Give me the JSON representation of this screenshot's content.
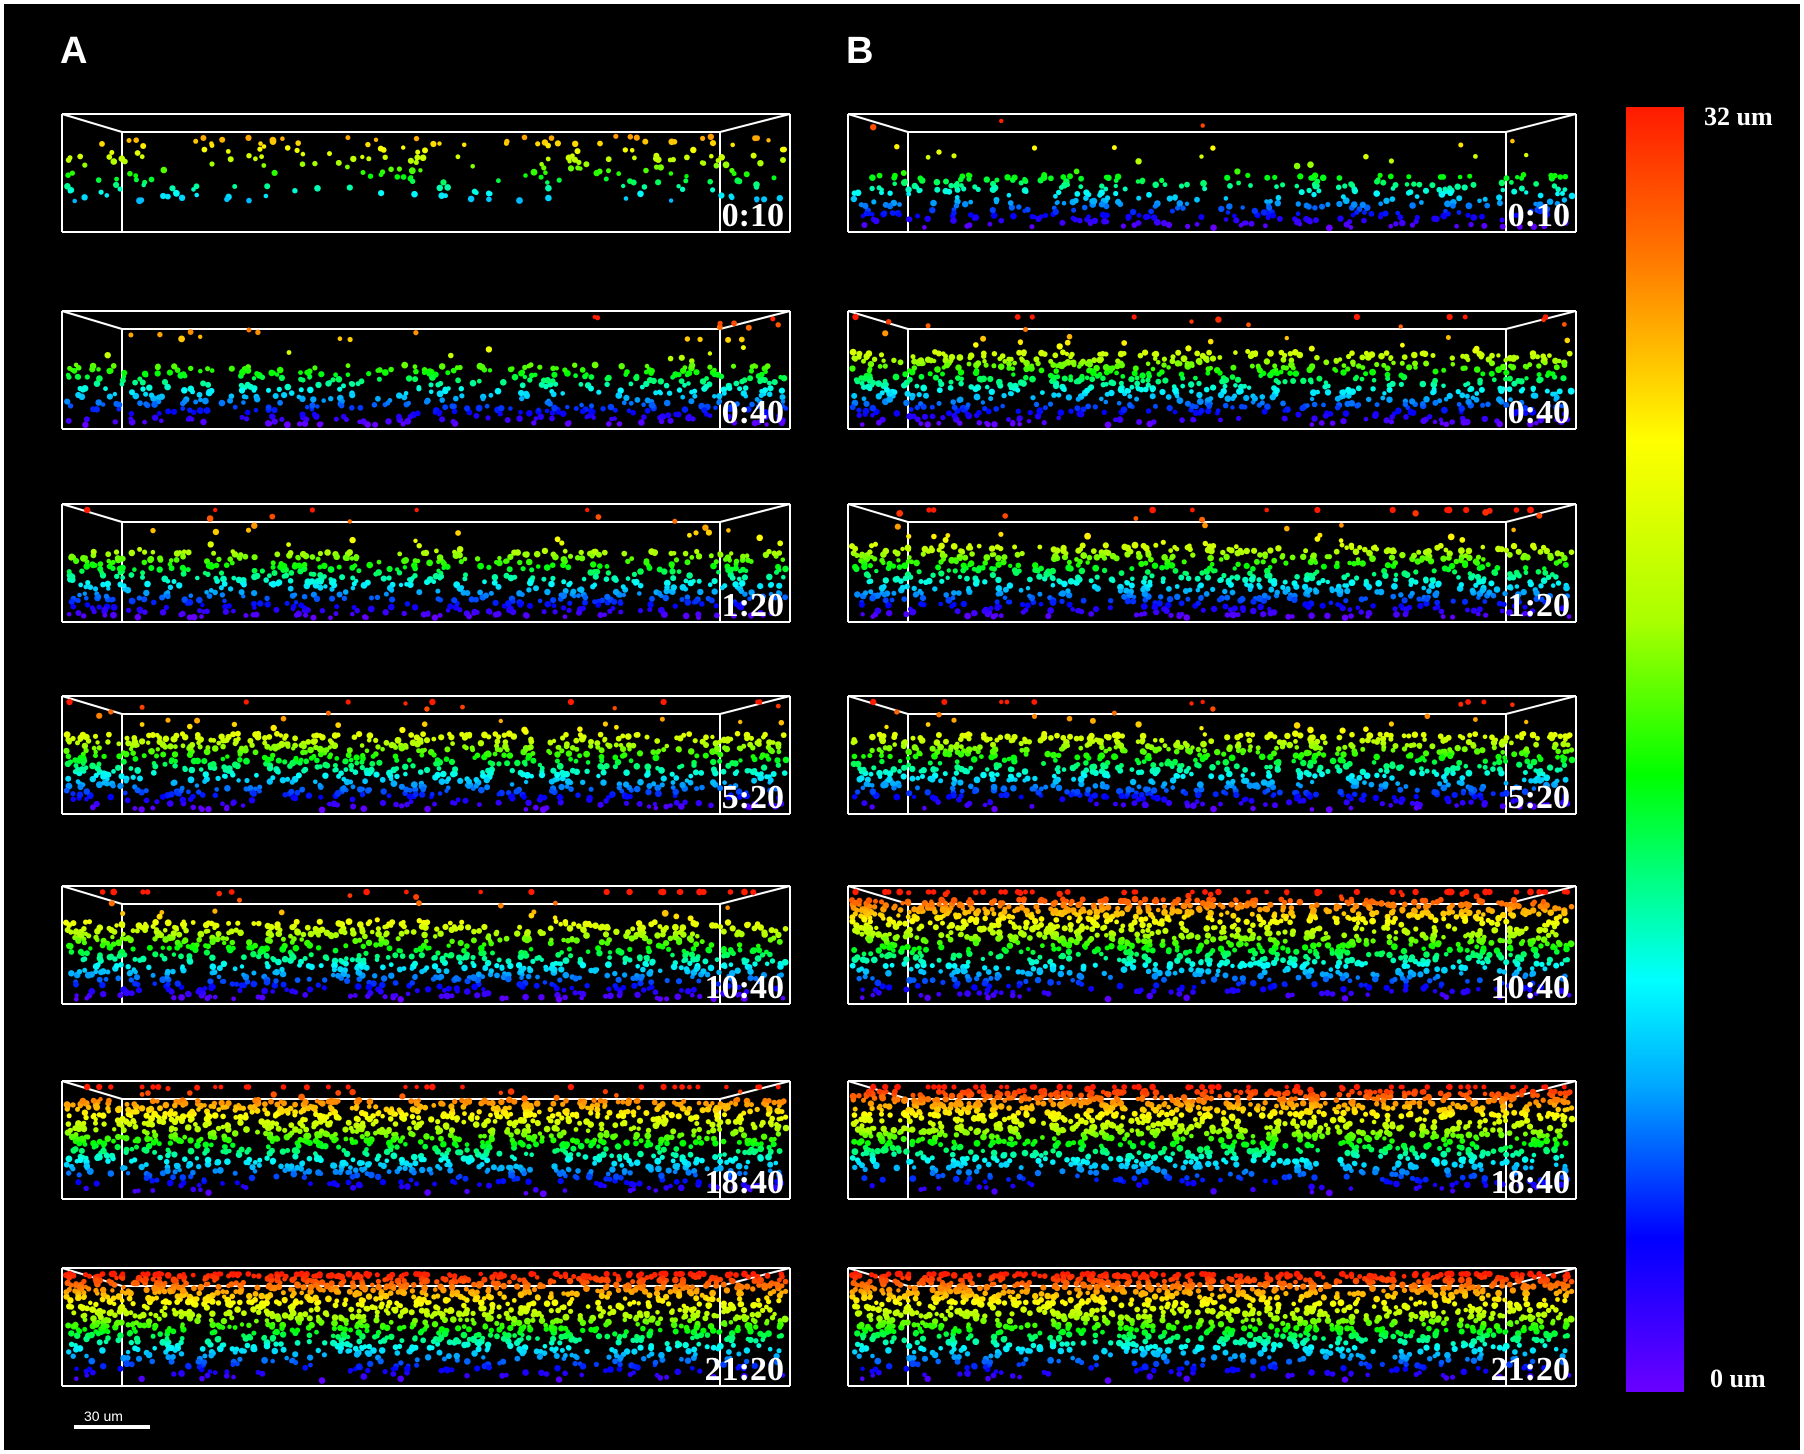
{
  "panels": [
    {
      "letter": "A",
      "times": [
        "0:10",
        "0:40",
        "1:20",
        "5:20",
        "10:40",
        "18:40",
        "21:20"
      ],
      "density": [
        0.08,
        0.32,
        0.42,
        0.55,
        0.58,
        0.82,
        1.0
      ]
    },
    {
      "letter": "B",
      "times": [
        "0:10",
        "0:40",
        "1:20",
        "5:20",
        "10:40",
        "18:40",
        "21:20"
      ],
      "density": [
        0.22,
        0.5,
        0.5,
        0.55,
        0.9,
        0.95,
        1.0
      ]
    }
  ],
  "colorbar": {
    "max_label": "32 um",
    "min_label": "0 um"
  },
  "scale_bar": {
    "label": "30 um"
  }
}
